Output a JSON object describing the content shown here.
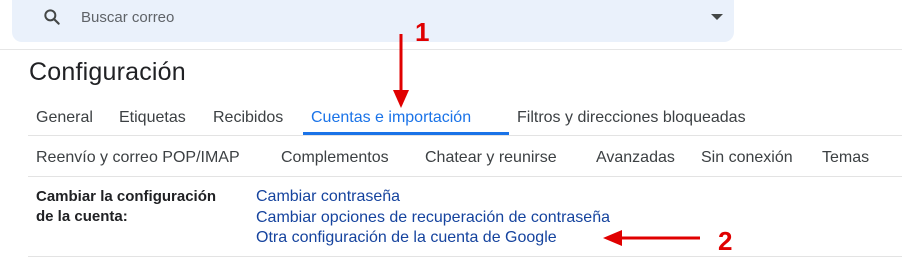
{
  "search": {
    "placeholder": "Buscar correo"
  },
  "page_title": "Configuración",
  "tabs_row1": [
    "General",
    "Etiquetas",
    "Recibidos",
    "Cuentas e importación",
    "Filtros y direcciones bloqueadas"
  ],
  "tabs_row2": [
    "Reenvío y correo POP/IMAP",
    "Complementos",
    "Chatear y reunirse",
    "Avanzadas",
    "Sin conexión",
    "Temas"
  ],
  "active_tab": "Cuentas e importación",
  "section": {
    "label_line1": "Cambiar la configuración",
    "label_line2": "de la cuenta:",
    "links": [
      "Cambiar contraseña",
      "Cambiar opciones de recuperación de contraseña",
      "Otra configuración de la cuenta de Google"
    ]
  },
  "annotations": {
    "first": "1",
    "second": "2"
  },
  "colors": {
    "accent": "#1a73e8",
    "link": "#15439e",
    "annotation": "#e00000",
    "search_bg": "#eaf1fb"
  },
  "icons": {
    "search": "search-icon",
    "dropdown": "caret-down-icon"
  }
}
